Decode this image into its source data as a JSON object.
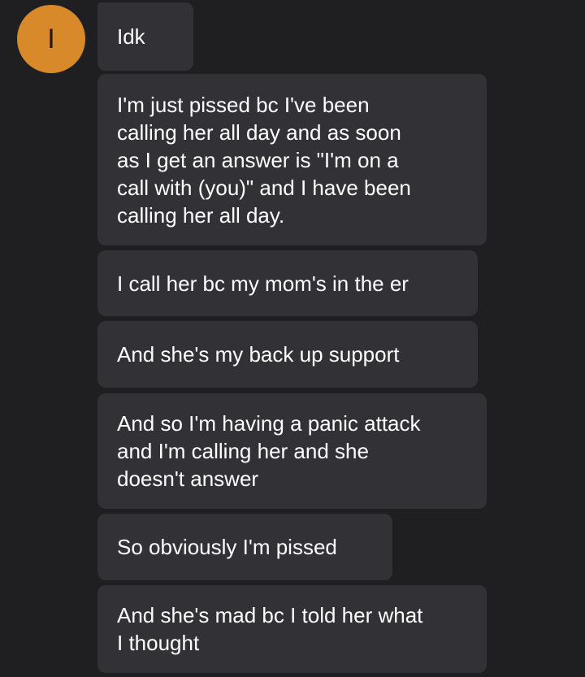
{
  "contact": {
    "avatar_initial": "I",
    "avatar_color": "#d88a2a"
  },
  "messages": [
    {
      "text": "Idk"
    },
    {
      "text": "I'm just pissed bc I've been\ncalling her all day and as soon\nas I get an answer is \"I'm on a\ncall with (you)\" and I have been\ncalling her all day."
    },
    {
      "text": "I call her bc my mom's in the er"
    },
    {
      "text": "And she's my back up support"
    },
    {
      "text": "And so I'm having a panic attack\nand I'm calling her and she\ndoesn't answer"
    },
    {
      "text": "So obviously I'm pissed"
    },
    {
      "text": "And she's mad bc I told her what\nI thought"
    }
  ],
  "colors": {
    "background": "#1f1f22",
    "bubble": "#323236",
    "text": "#ffffff"
  }
}
